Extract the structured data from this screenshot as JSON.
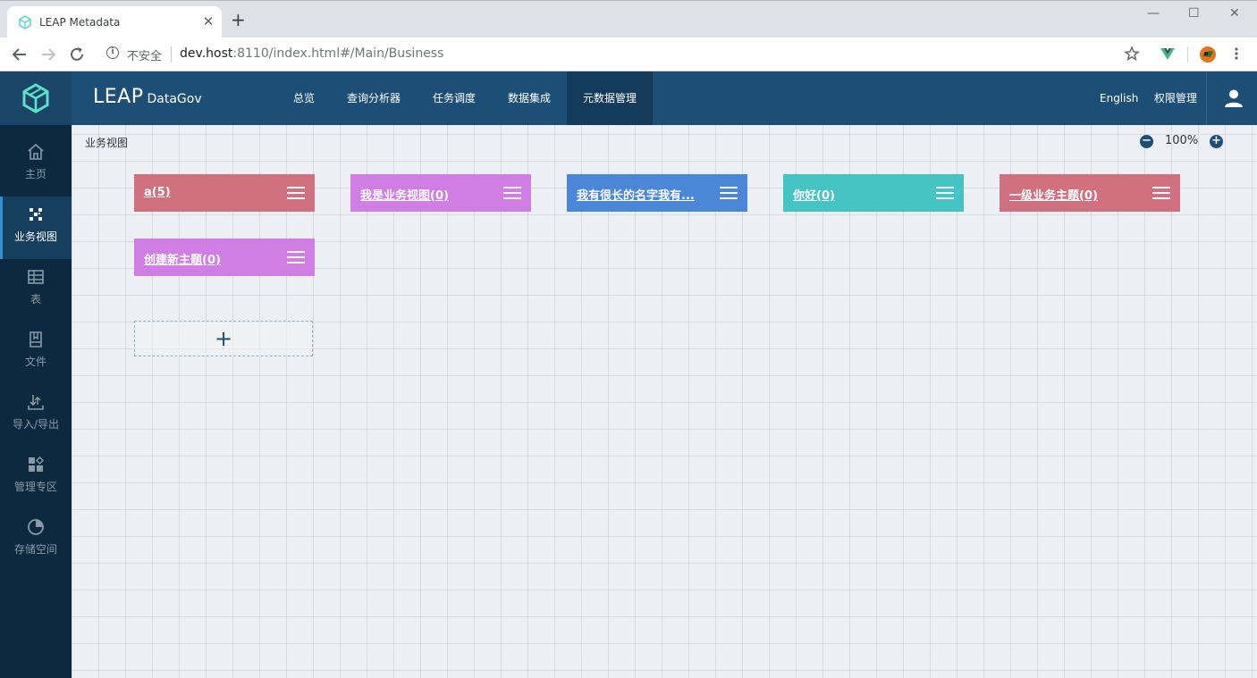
{
  "browser": {
    "tab_title": "LEAP Metadata",
    "tab_close": "✕",
    "new_tab": "+",
    "window_min": "—",
    "window_max": "☐",
    "window_close": "✕",
    "security_label": "不安全",
    "url_host": "dev.host",
    "url_rest": ":8110/index.html#/Main/Business"
  },
  "header": {
    "brand_main": "LEAP",
    "brand_sub": "DataGov",
    "nav": [
      {
        "label": "总览"
      },
      {
        "label": "查询分析器"
      },
      {
        "label": "任务调度"
      },
      {
        "label": "数据集成"
      },
      {
        "label": "元数据管理",
        "active": true
      }
    ],
    "language": "English",
    "permissions": "权限管理"
  },
  "sidebar": {
    "items": [
      {
        "label": "主页",
        "icon": "home-icon"
      },
      {
        "label": "业务视图",
        "icon": "business-view-icon",
        "active": true
      },
      {
        "label": "表",
        "icon": "table-icon"
      },
      {
        "label": "文件",
        "icon": "file-icon"
      },
      {
        "label": "导入/导出",
        "icon": "import-export-icon"
      },
      {
        "label": "管理专区",
        "icon": "manage-icon"
      },
      {
        "label": "存储空间",
        "icon": "storage-icon"
      }
    ]
  },
  "main": {
    "breadcrumb": "业务视图",
    "zoom_out": "−",
    "zoom_in": "+",
    "zoom_level": "100%",
    "add_symbol": "+",
    "cards": [
      {
        "title": "a(5)",
        "color": "#d1707f"
      },
      {
        "title": "我是业务视图(0)",
        "color": "#d17de6"
      },
      {
        "title": "我有很长的名字我有...",
        "color": "#4a87d9"
      },
      {
        "title": "你好(0)",
        "color": "#45c4c4"
      },
      {
        "title": "一级业务主题(0)",
        "color": "#d1707f"
      },
      {
        "title": "创建新主题(0)",
        "color": "#d17de6"
      }
    ]
  }
}
